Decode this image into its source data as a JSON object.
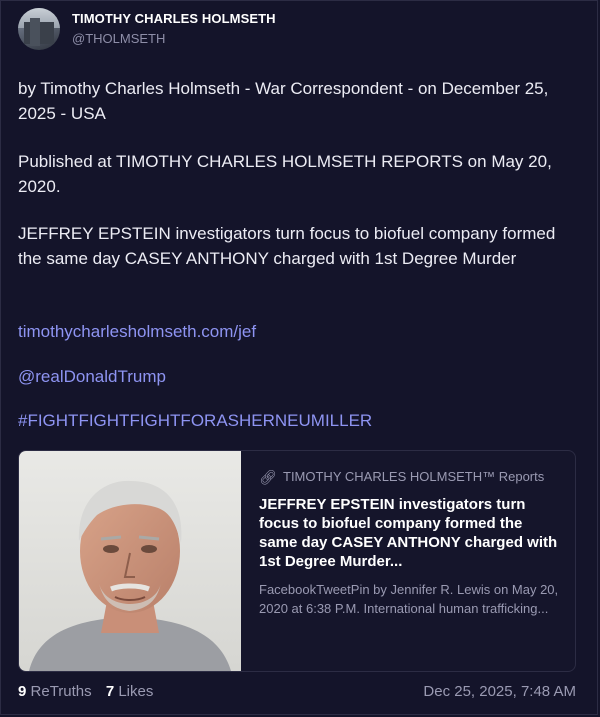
{
  "author": {
    "display_name": "TIMOTHY CHARLES HOLMSETH",
    "handle": "@THOLMSETH"
  },
  "post": {
    "byline": "by Timothy Charles Holmseth - War Correspondent - on December 25, 2025 - USA",
    "published": "Published at TIMOTHY CHARLES HOLMSETH REPORTS on May 20, 2020.",
    "headline": "JEFFREY EPSTEIN investigators turn focus to biofuel company formed the same day CASEY ANTHONY charged with 1st Degree Murder",
    "url": "timothycharlesholmseth.com/jef",
    "mention": "@realDonaldTrump",
    "hashtag": "#FIGHTFIGHTFIGHTFORASHERNEUMILLER"
  },
  "link_card": {
    "site_name": "TIMOTHY CHARLES HOLMSETH™ Reports",
    "title": "JEFFREY EPSTEIN investigators turn focus to biofuel company formed the same day CASEY ANTHONY charged with 1st Degree Murder...",
    "description": "FacebookTweetPin by Jennifer R. Lewis on May 20, 2020 at 6:38 P.M. International human trafficking...",
    "icon": "link-icon"
  },
  "stats": {
    "retruths_count": "9",
    "retruths_label": "ReTruths",
    "likes_count": "7",
    "likes_label": "Likes",
    "timestamp": "Dec 25, 2025, 7:48 AM"
  },
  "colors": {
    "background": "#14142a",
    "link": "#8e94f2",
    "muted": "#9a9ab2"
  }
}
